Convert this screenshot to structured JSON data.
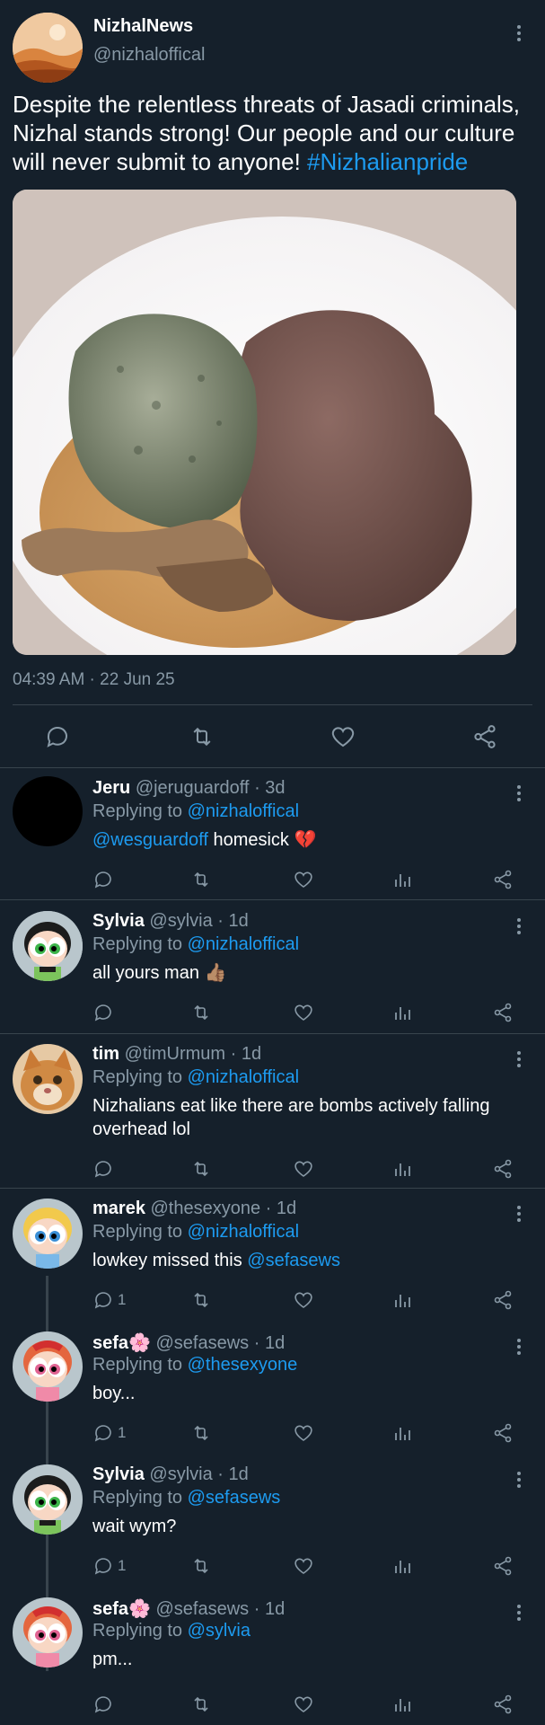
{
  "main_tweet": {
    "author_name": "NizhalNews",
    "author_handle": "@nizhaloffical",
    "text_before": "Despite the relentless threats of Jasadi criminals, Nizhal stands strong! Our people and our culture will never submit to anyone! ",
    "hashtag": "#Nizhalianpride",
    "timestamp": "04:39 AM · 22 Jun 25",
    "image_icon": "food-plate-image"
  },
  "replies": [
    {
      "name": "Jeru",
      "handle": "@jeruguardoff",
      "age": "· 3d",
      "replying_prefix": "Replying to",
      "replying_to": "@nizhaloffical",
      "mention": "@wesguardoff",
      "text": " homesick ",
      "emoji": "💔",
      "reply_count": ""
    },
    {
      "name": "Sylvia",
      "handle": "@sylvia",
      "age": "· 1d",
      "replying_prefix": "Replying to",
      "replying_to": "@nizhaloffical",
      "mention": "",
      "text": "all yours man ",
      "emoji": "👍🏽",
      "reply_count": ""
    },
    {
      "name": "tim",
      "handle": "@timUrmum",
      "age": "· 1d",
      "replying_prefix": "Replying to",
      "replying_to": "@nizhaloffical",
      "mention": "",
      "text": "Nizhalians eat like there are bombs actively falling overhead lol",
      "emoji": "",
      "reply_count": ""
    },
    {
      "name": "marek",
      "handle": "@thesexyone",
      "age": "· 1d",
      "replying_prefix": "Replying to",
      "replying_to": "@nizhaloffical",
      "mention": "",
      "text": "lowkey missed this ",
      "mention_after": "@sefasews",
      "emoji": "",
      "reply_count": "1"
    },
    {
      "name": "sefa",
      "name_emoji": "🌸",
      "handle": "@sefasews",
      "age": "· 1d",
      "replying_prefix": "Replying to",
      "replying_to": "@thesexyone",
      "mention": "",
      "text": "boy...",
      "emoji": "",
      "reply_count": "1"
    },
    {
      "name": "Sylvia",
      "handle": "@sylvia",
      "age": "· 1d",
      "replying_prefix": "Replying to",
      "replying_to": "@sefasews",
      "mention": "",
      "text": "wait wym?",
      "emoji": "",
      "reply_count": "1"
    },
    {
      "name": "sefa",
      "name_emoji": "🌸",
      "handle": "@sefasews",
      "age": "· 1d",
      "replying_prefix": "Replying to",
      "replying_to": "@sylvia",
      "mention": "",
      "text": "pm...",
      "emoji": "",
      "reply_count": ""
    }
  ],
  "colors": {
    "background": "#15202b",
    "muted": "#8899a6",
    "accent": "#1d9bf0",
    "divider": "#38444d"
  }
}
